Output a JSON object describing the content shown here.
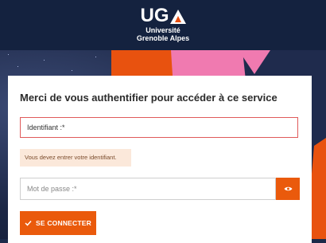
{
  "logo": {
    "mark": "UG",
    "line1": "Université",
    "line2": "Grenoble Alpes"
  },
  "login": {
    "title": "Merci de vous authentifier pour accéder à ce service",
    "username_placeholder": "Identifiant :*",
    "error_message": "Vous devez entrer votre identifiant.",
    "password_placeholder": "Mot de passe :*",
    "submit_label": "SE CONNECTER"
  },
  "colors": {
    "accent": "#ea5a0c",
    "pink": "#f07ab0",
    "header": "#14223f",
    "error_border": "#e05a5a",
    "alert_bg": "#fbe8da"
  },
  "icons": {
    "password_toggle": "eye-icon",
    "submit": "check-icon"
  }
}
